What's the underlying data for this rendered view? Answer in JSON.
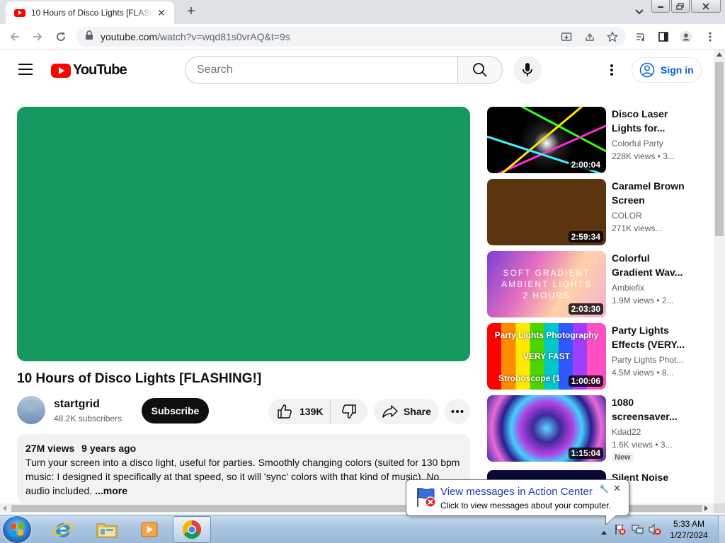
{
  "browser": {
    "tab_title": "10 Hours of Disco Lights [FLASHING!]",
    "url_host": "youtube.com",
    "url_path": "/watch?v=wqd81s0vrAQ&t=9s"
  },
  "header": {
    "logo_text": "YouTube",
    "search_placeholder": "Search",
    "signin_label": "Sign in"
  },
  "video": {
    "player_color": "#159961",
    "title": "10 Hours of Disco Lights [FLASHING!]",
    "channel": "startgrid",
    "subscribers": "48.2K subscribers",
    "subscribe_label": "Subscribe",
    "likes": "139K",
    "share_label": "Share",
    "views": "27M views",
    "age": "9 years ago",
    "description": "Turn your screen into a disco light, useful for parties. Smoothly changing colors (suited for 130 bpm music: I designed it specifically at that speed, so it will 'sync' colors with that kind of music). No audio included.",
    "more_label": "...more"
  },
  "related": [
    {
      "title": "Disco Laser Lights for...",
      "channel": "Colorful Party",
      "meta": "228K views • 3...",
      "duration": "2:00:04"
    },
    {
      "title": "Caramel Brown Screen",
      "channel": "COLOR",
      "meta": "271K views...",
      "duration": "2:59:34"
    },
    {
      "title": "Colorful Gradient Wav...",
      "channel": "Ambiefix",
      "meta": "1.9M views • 2...",
      "duration": "2:03:30",
      "thumb_text": [
        "SOFT GRADIENT",
        "AMBIENT LIGHTS",
        "2 HOURS"
      ]
    },
    {
      "title": "Party Lights Effects (VERY...",
      "channel": "Party Lights Phot...",
      "meta": "4.5M views • 8...",
      "duration": "1:00:06",
      "thumb_text": [
        "Party Lights Photography",
        "VERY FAST",
        "Stroboscope (1"
      ]
    },
    {
      "title": "1080 screensaver...",
      "channel": "Kdad22",
      "meta": "1.6K views • 3...",
      "duration": "1:15:04",
      "badge": "New"
    },
    {
      "title": "Silent Noise"
    }
  ],
  "notification": {
    "title": "View messages in Action Center",
    "subtitle": "Click to view messages about your computer."
  },
  "taskbar": {
    "time": "5:33 AM",
    "date": "1/27/2024"
  }
}
